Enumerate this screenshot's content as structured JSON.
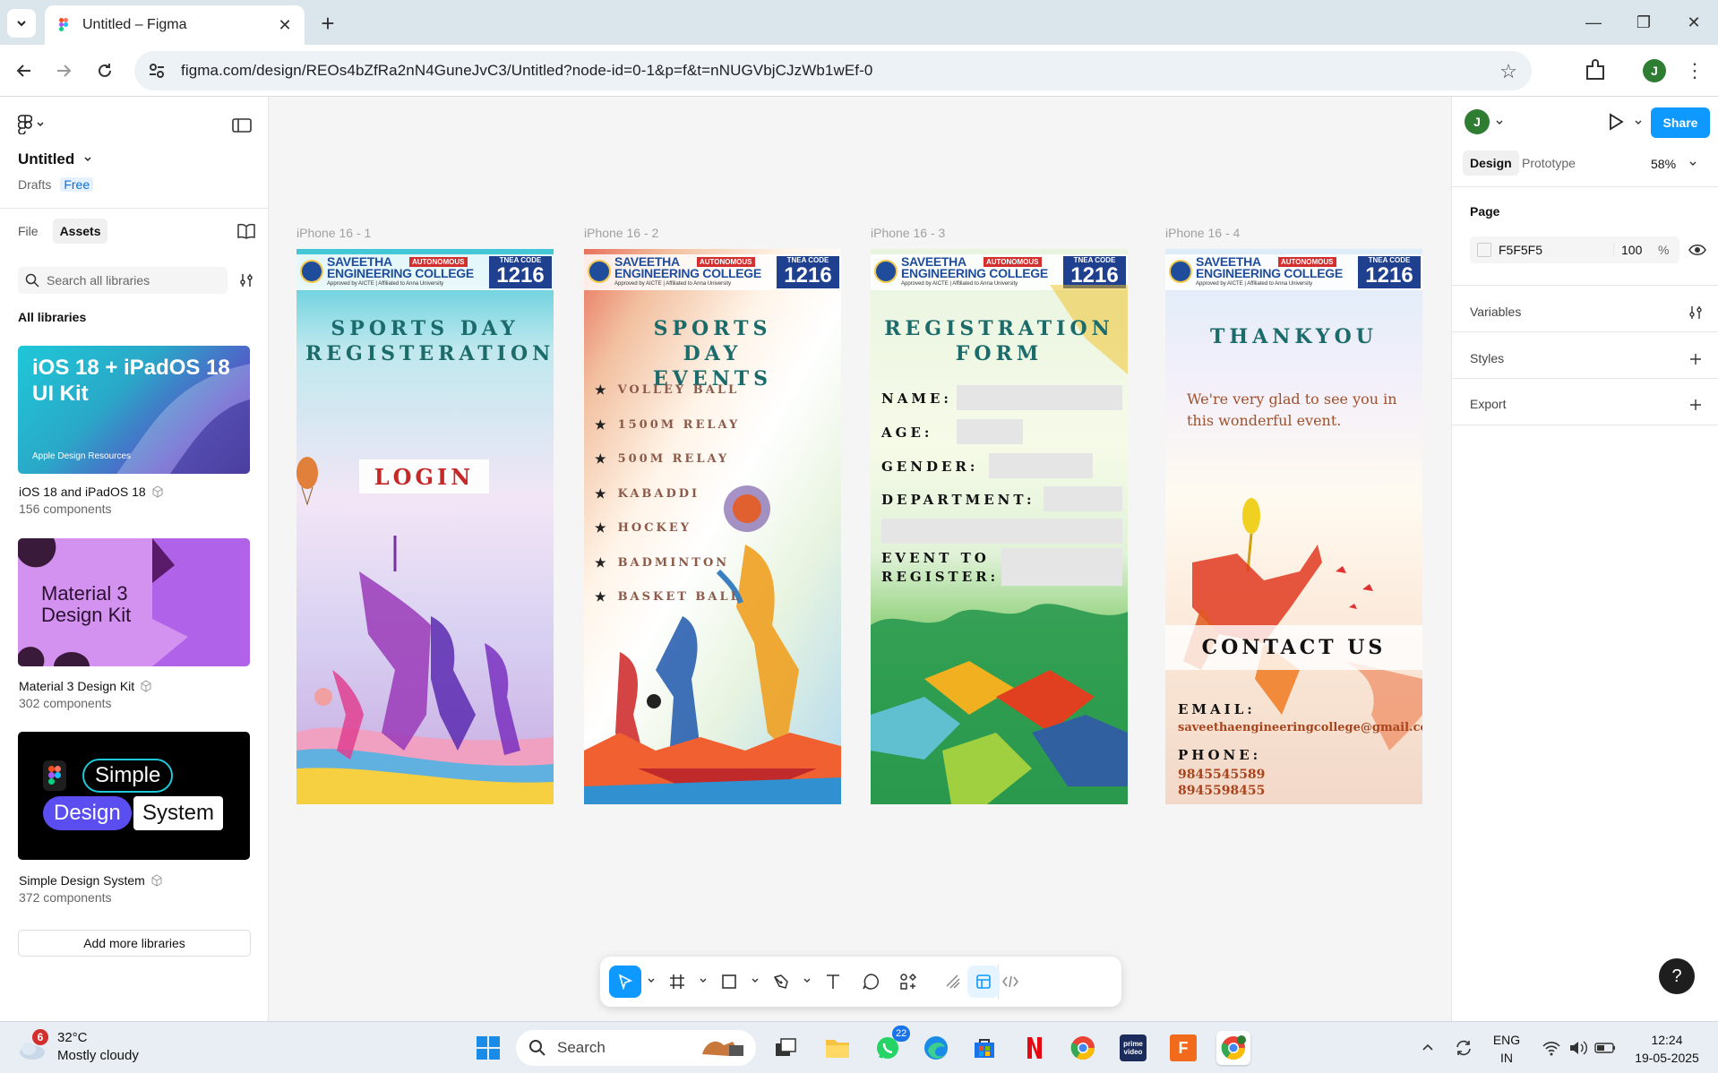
{
  "browser": {
    "tab_title": "Untitled – Figma",
    "url": "figma.com/design/REOs4bZfRa2nN4GuneJvC3/Untitled?node-id=0-1&p=f&t=nNUGVbjCJzWb1wEf-0",
    "profile_initial": "J"
  },
  "left_panel": {
    "file_title": "Untitled",
    "location": "Drafts",
    "plan": "Free",
    "tabs": [
      "File",
      "Assets"
    ],
    "active_tab": "Assets",
    "search_placeholder": "Search all libraries",
    "section_title": "All libraries",
    "libraries": [
      {
        "name": "iOS 18 and iPadOS 18",
        "count": "156 components",
        "thumb_title": "iOS 18 + iPadOS 18 UI Kit",
        "thumb_caption": "Apple Design Resources"
      },
      {
        "name": "Material 3 Design Kit",
        "count": "302 components",
        "thumb_title": "Material 3 Design Kit"
      },
      {
        "name": "Simple Design System",
        "count": "372 components",
        "thumb_words": [
          "Simple",
          "Design",
          "System"
        ]
      }
    ],
    "add_button": "Add more libraries"
  },
  "canvas": {
    "frames": [
      {
        "label": "iPhone 16 - 1",
        "title": "SPORTS DAY REGISTERATION",
        "button": "LOGIN"
      },
      {
        "label": "iPhone 16 - 2",
        "title": "SPORTS DAY EVENTS",
        "events": [
          "VOLLEY BALL",
          "1500M RELAY",
          "500M RELAY",
          "KABADDI",
          "HOCKEY",
          "BADMINTON",
          "BASKET BALL"
        ]
      },
      {
        "label": "iPhone 16 - 3",
        "title": "REGISTRATION FORM",
        "fields": [
          "NAME:",
          "AGE:",
          "GENDER:",
          "DEPARTMENT:",
          "EVENT TO",
          "REGISTER:"
        ]
      },
      {
        "label": "iPhone 16 - 4",
        "title": "THANKYOU",
        "message": "We're very glad to see you in this wonderful event.",
        "contact_title": "CONTACT US",
        "email_label": "EMAIL:",
        "email": "saveethaengineeringcollege@gmail.com",
        "phone_label": "PHONE:",
        "phones": [
          "9845545589",
          "8945598455"
        ]
      }
    ],
    "college_header": {
      "name_line1": "SAVEETHA",
      "name_line2": "ENGINEERING COLLEGE",
      "autonomous": "AUTONOMOUS",
      "sub": "Approved by AICTE | Affiliated to Anna University",
      "code_label": "TNEA CODE",
      "code": "1216"
    }
  },
  "right_panel": {
    "avatar_initial": "J",
    "share_label": "Share",
    "tabs": [
      "Design",
      "Prototype"
    ],
    "active_tab": "Design",
    "zoom": "58%",
    "page_heading": "Page",
    "page_color": "F5F5F5",
    "page_opacity": "100",
    "percent_sign": "%",
    "rows": [
      "Variables",
      "Styles",
      "Export"
    ]
  },
  "help_label": "?",
  "taskbar": {
    "weather_temp": "32°C",
    "weather_desc": "Mostly cloudy",
    "weather_badge": "6",
    "search_label": "Search",
    "whatsapp_badge": "22",
    "lang_line1": "ENG",
    "lang_line2": "IN",
    "time": "12:24",
    "date": "19-05-2025"
  },
  "colors": {
    "accent": "#0d99ff",
    "canvas": "#f5f5f5",
    "title_teal": "#1c6b6b",
    "login_red": "#c62828"
  }
}
